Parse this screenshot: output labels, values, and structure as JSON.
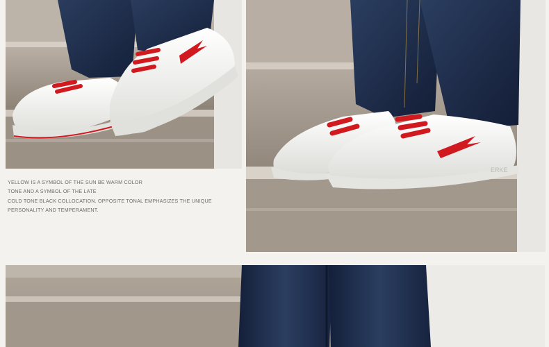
{
  "caption": {
    "lines": [
      "YELLOW IS A SYMBOL OF THE SUN BE WARM COLOR",
      "TONE AND A SYMBOL OF THE LATE",
      "COLD TONE BLACK COLLOCATION. OPPOSITE TONAL EMPHASIZES THE UNIQUE",
      "PERSONALITY AND TEMPERAMENT."
    ]
  },
  "photos": {
    "top_left": {
      "subject": "white sneakers with red laces on stone stairs, jeans"
    },
    "top_right": {
      "subject": "white sneakers with red laces on stone stairs, jeans"
    },
    "bottom": {
      "subject": "jeans legs on stairs, cropped"
    }
  },
  "colors": {
    "page_background": "#f4f2ef",
    "denim": "#1d2b45",
    "shoe_white": "#f5f5f3",
    "lace_red": "#d11a1f",
    "stone": "#a79c90",
    "caption_text": "#6d6a66"
  },
  "shoe_logo_text": "ERKE"
}
